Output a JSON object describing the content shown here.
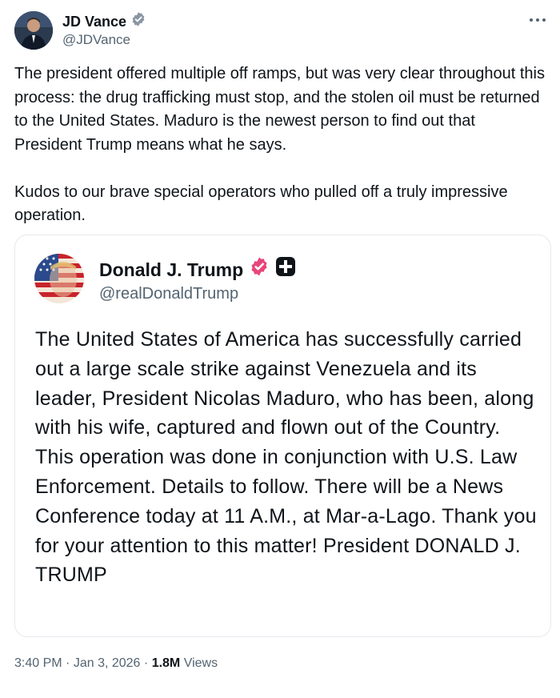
{
  "author": {
    "name": "JD Vance",
    "handle": "@JDVance"
  },
  "tweet": {
    "paragraphs": [
      "The president offered multiple off ramps, but was very clear throughout this process: the drug trafficking must stop, and the stolen oil must be returned to the United States. Maduro is the newest person to find out that President Trump means what he says.",
      "Kudos to our brave special operators who pulled off a truly impressive operation."
    ]
  },
  "quoted": {
    "name": "Donald J. Trump",
    "handle": "@realDonaldTrump",
    "text": "The United States of America has successfully carried out a large scale strike against Venezuela and its leader, President Nicolas Maduro, who has been, along with his wife, captured and flown out of the Country. This operation was done in conjunction with U.S. Law Enforcement. Details to follow. There will be a News Conference today at 11 A.M., at Mar-a-Lago. Thank you for your attention to this matter! President DONALD J. TRUMP"
  },
  "meta": {
    "time": "3:40 PM",
    "separator": "·",
    "date": "Jan 3, 2026",
    "views_count": "1.8M",
    "views_label": "Views"
  },
  "icons": {
    "verified": "verified-badge-icon",
    "more": "more-options-icon",
    "truth_social": "truth-social-icon"
  },
  "colors": {
    "verified_blue": "#1d9bf0",
    "truth_verified_pink": "#e8457a",
    "secondary_text": "#536471",
    "primary_text": "#0f1419"
  }
}
